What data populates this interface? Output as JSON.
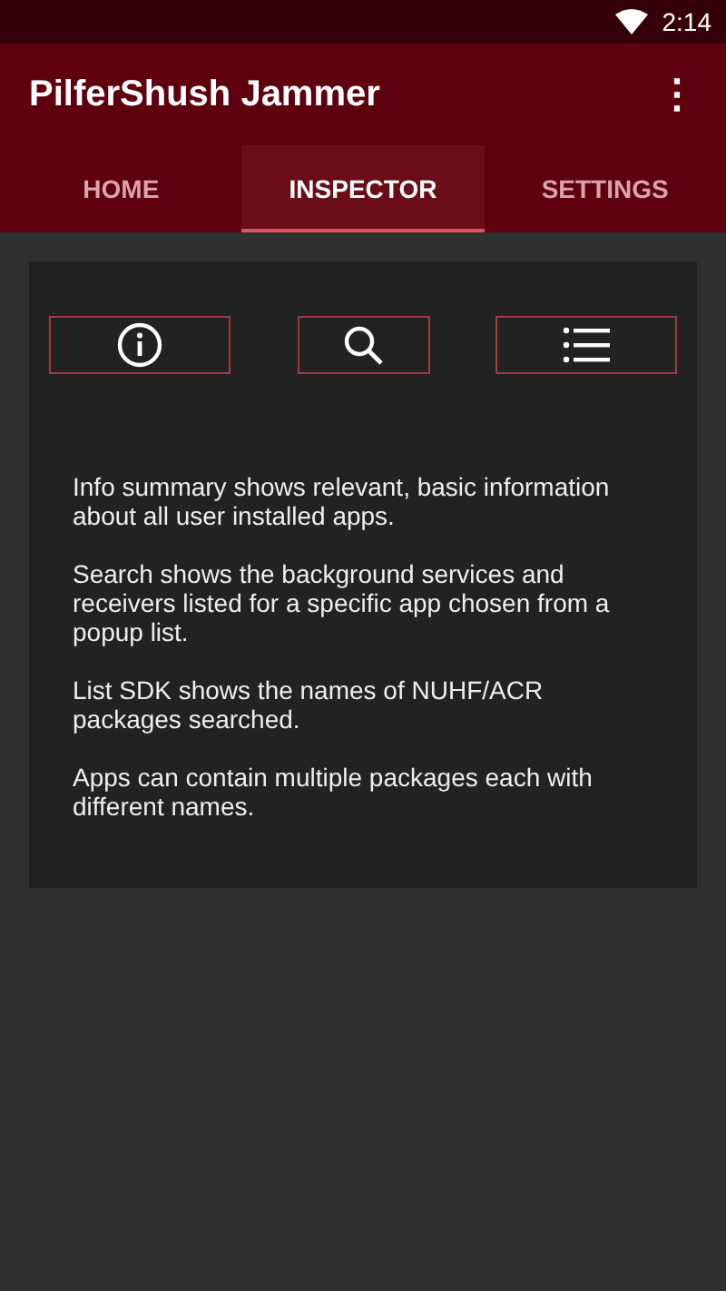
{
  "status_bar": {
    "time": "2:14"
  },
  "app_bar": {
    "title": "PilferShush Jammer",
    "menu": "⋮"
  },
  "tabs": [
    {
      "label": "HOME",
      "selected": false
    },
    {
      "label": "INSPECTOR",
      "selected": true
    },
    {
      "label": "SETTINGS",
      "selected": false
    }
  ],
  "tools": [
    {
      "kind": "info"
    },
    {
      "kind": "search"
    },
    {
      "kind": "list"
    }
  ],
  "paragraphs": [
    "Info summary shows relevant, basic information about all user installed apps.",
    "Search shows the background services and receivers listed for a specific app chosen from a popup list.",
    "List SDK shows the names of NUHF/ACR packages searched.",
    "Apps can contain multiple packages each with different names."
  ]
}
